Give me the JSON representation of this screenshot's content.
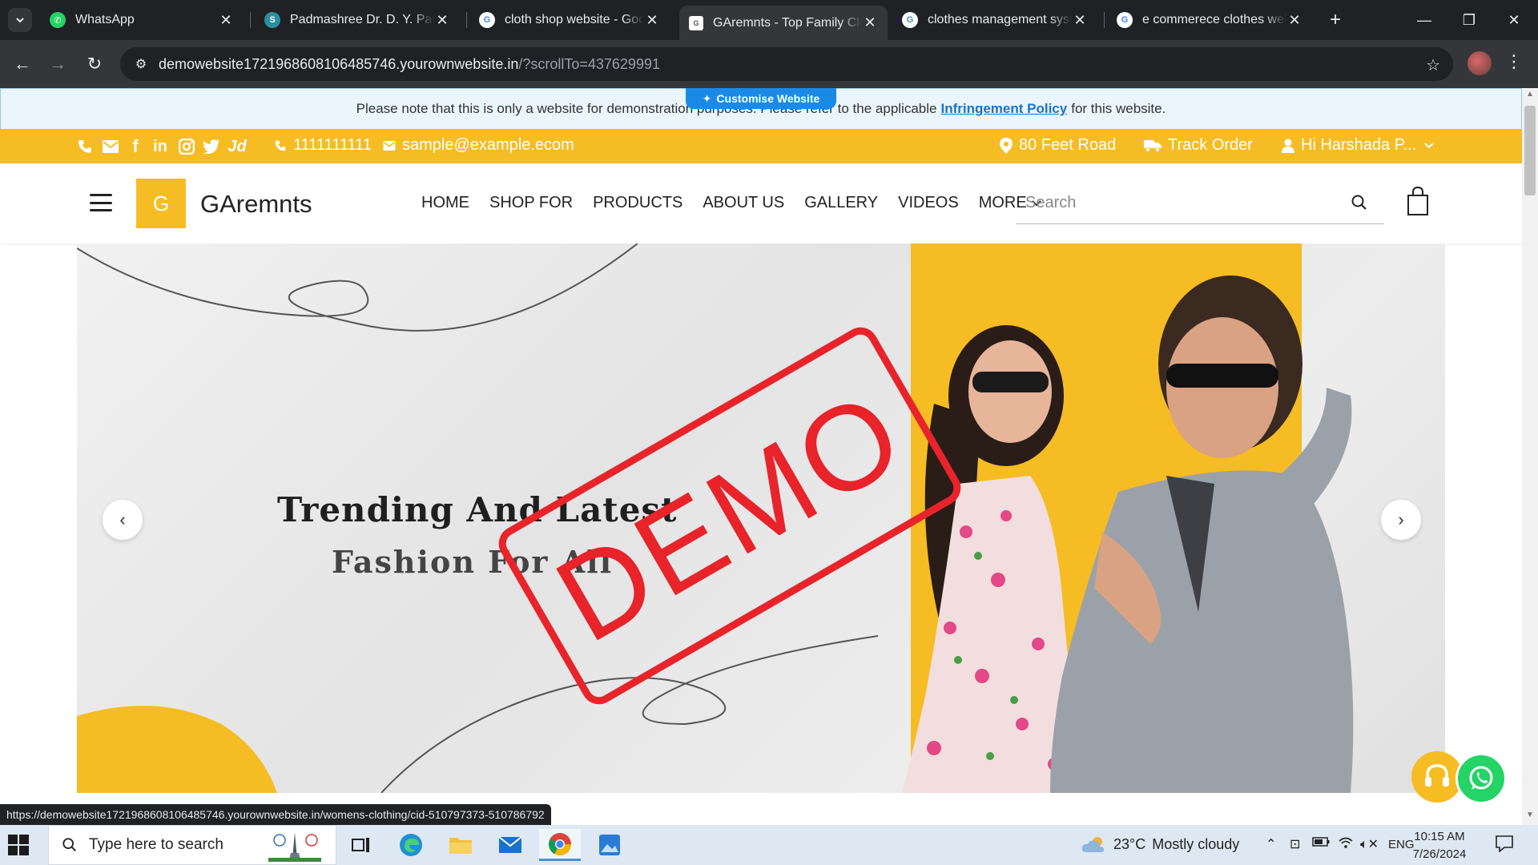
{
  "browser": {
    "tabs": [
      {
        "title": "WhatsApp",
        "active": false
      },
      {
        "title": "Padmashree Dr. D. Y. Patil Sc",
        "active": false
      },
      {
        "title": "cloth shop website - Google",
        "active": false
      },
      {
        "title": "GAremnts - Top Family Clothi",
        "active": true
      },
      {
        "title": "clothes management system",
        "active": false
      },
      {
        "title": "e commerece clothes website",
        "active": false
      }
    ],
    "address": {
      "host": "demowebsite1721968608106485746.yourownwebsite.in",
      "path": "/?scrollTo=437629991"
    }
  },
  "site": {
    "notice": {
      "before": "Please note that this is only a website for demonstration purposes. Please refer to the applicable",
      "link": "Infringement Policy",
      "after": "for this website."
    },
    "customise_label": "Customise Website",
    "topbar": {
      "phone": "1111111111",
      "email": "sample@example.ecom",
      "address": "80 Feet Road",
      "track_order": "Track Order",
      "user": "Hi Harshada P..."
    },
    "brand": {
      "logo_letter": "G",
      "name": "GAremnts"
    },
    "menu": [
      "HOME",
      "SHOP FOR",
      "PRODUCTS",
      "ABOUT US",
      "GALLERY",
      "VIDEOS",
      "MORE"
    ],
    "search_placeholder": "Search",
    "hero": {
      "line1": "Trending And Latest",
      "line2": "Fashion For All",
      "stamp": "DEMO"
    }
  },
  "status_url": "https://demowebsite1721968608106485746.yourownwebsite.in/womens-clothing/cid-510797373-510786792",
  "taskbar": {
    "search_placeholder": "Type here to search",
    "weather_temp": "23°C",
    "weather_desc": "Mostly cloudy",
    "lang": "ENG",
    "time": "10:15 AM",
    "date": "7/26/2024"
  },
  "colors": {
    "brand_yellow": "#f6bc23",
    "stamp_red": "#e8232a",
    "link_blue": "#1a73c9"
  },
  "icons": [
    "whatsapp-icon",
    "phone-icon",
    "mail-icon",
    "facebook-icon",
    "linkedin-icon",
    "instagram-icon",
    "twitter-icon",
    "justdial-icon",
    "location-icon",
    "truck-icon",
    "user-icon",
    "search-icon",
    "shopping-bag-icon",
    "headset-icon"
  ]
}
